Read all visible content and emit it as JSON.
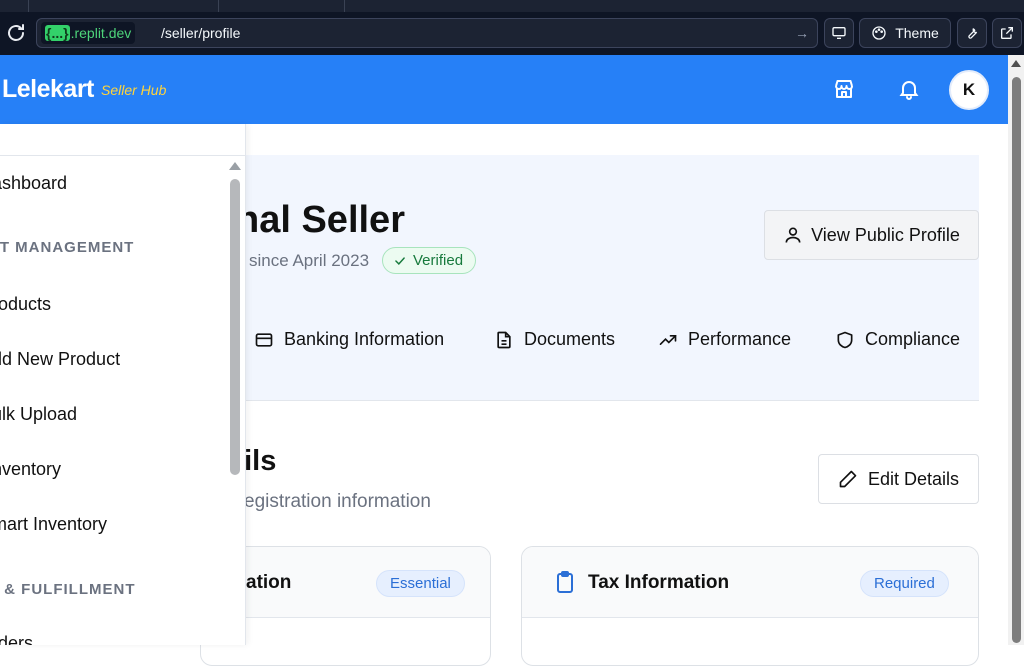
{
  "browser": {
    "url_host_prefix": "{...}",
    "url_host": ".replit.dev",
    "url_path": "/seller/profile",
    "theme_label": "Theme"
  },
  "header": {
    "brand": "Lelekart",
    "brand_sub": "Seller Hub",
    "avatar_initial": "K",
    "colors": {
      "header_bg": "#2680f7",
      "brand_sub": "#ffd43b"
    }
  },
  "sidebar": {
    "items": [
      {
        "label": "ashboard"
      },
      {
        "label": "CT MANAGEMENT",
        "heading": true
      },
      {
        "label": "roducts"
      },
      {
        "label": "dd New Product"
      },
      {
        "label": "ulk Upload"
      },
      {
        "label": "nventory"
      },
      {
        "label": "mart Inventory"
      },
      {
        "label": "S & FULFILLMENT",
        "heading": true
      },
      {
        "label": "rders"
      }
    ]
  },
  "profile": {
    "name": "hal Seller",
    "since": "since April 2023",
    "verified_label": "Verified",
    "view_public_label": "View Public Profile",
    "tabs": [
      {
        "label": "Banking Information",
        "icon": "credit-card-icon"
      },
      {
        "label": "Documents",
        "icon": "file-text-icon"
      },
      {
        "label": "Performance",
        "icon": "trending-up-icon"
      },
      {
        "label": "Compliance",
        "icon": "shield-icon"
      }
    ]
  },
  "section": {
    "title": "ails",
    "subtitle": "egistration information",
    "edit_label": "Edit Details"
  },
  "cards": [
    {
      "title": "ation",
      "badge": "Essential"
    },
    {
      "title": "Tax Information",
      "badge": "Required",
      "icon": "clipboard-icon"
    }
  ]
}
